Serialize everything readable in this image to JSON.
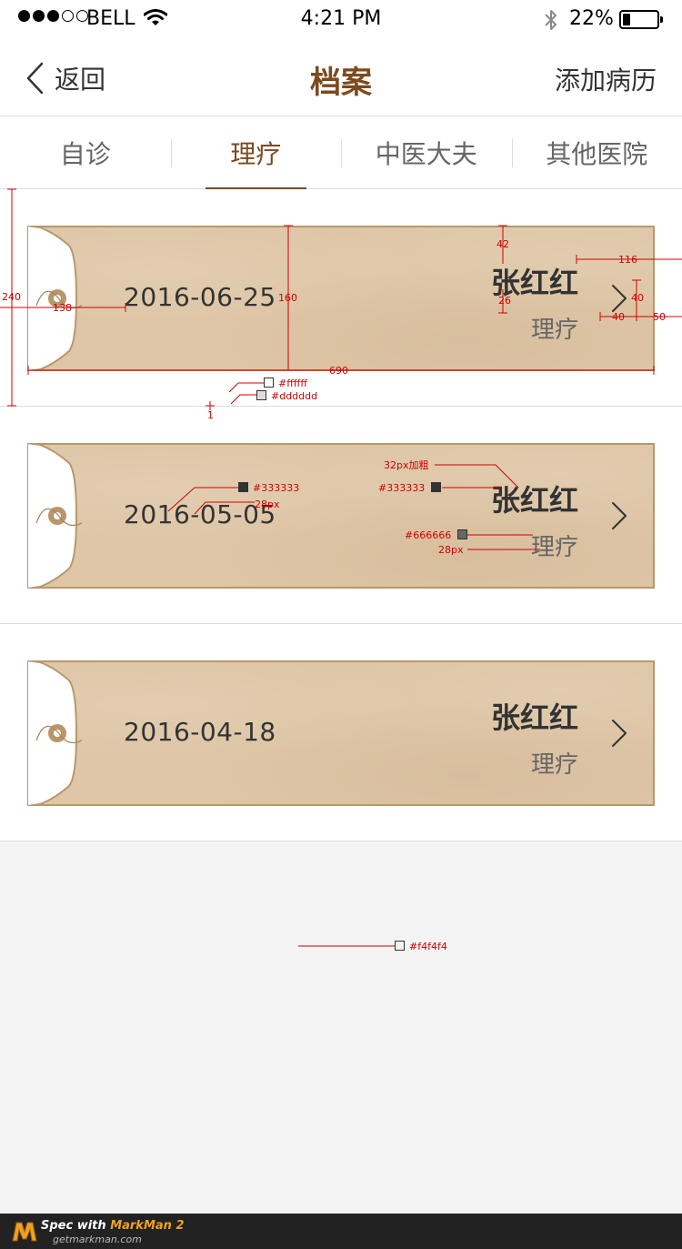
{
  "status_bar": {
    "carrier": "BELL",
    "time": "4:21 PM",
    "battery_percent_text": "22%",
    "battery_level": 0.22,
    "signal_bars_filled": 3,
    "signal_bars_total": 5
  },
  "nav": {
    "back_label": "返回",
    "title": "档案",
    "action_label": "添加病历",
    "accent_color": "#7b4a1e"
  },
  "tabs": [
    {
      "label": "自诊",
      "active": false
    },
    {
      "label": "理疗",
      "active": true
    },
    {
      "label": "中医大夫",
      "active": false
    },
    {
      "label": "其他医院",
      "active": false
    }
  ],
  "records": [
    {
      "date": "2016-06-25",
      "name": "张红红",
      "type": "理疗"
    },
    {
      "date": "2016-05-05",
      "name": "张红红",
      "type": "理疗"
    },
    {
      "date": "2016-04-18",
      "name": "张红红",
      "type": "理疗"
    }
  ],
  "annotations": {
    "row_height": "240",
    "flap_width": "138",
    "card_height": "160",
    "card_width": "690",
    "name_top": "42",
    "name_gap": "26",
    "right_offset": "116",
    "chevron_height": "40",
    "chevron_left": "40",
    "chevron_right": "50",
    "color_white": "#ffffff",
    "color_divider": "#dddddd",
    "divider_height": "1",
    "color_date": "#333333",
    "date_size": "28px",
    "name_spec": "32px加粗",
    "color_name": "#333333",
    "color_type": "#666666",
    "type_size": "28px",
    "color_background": "#f4f4f4"
  },
  "footer": {
    "prefix": "Spec with ",
    "brand": "MarkMan 2",
    "url": "getmarkman.com"
  }
}
